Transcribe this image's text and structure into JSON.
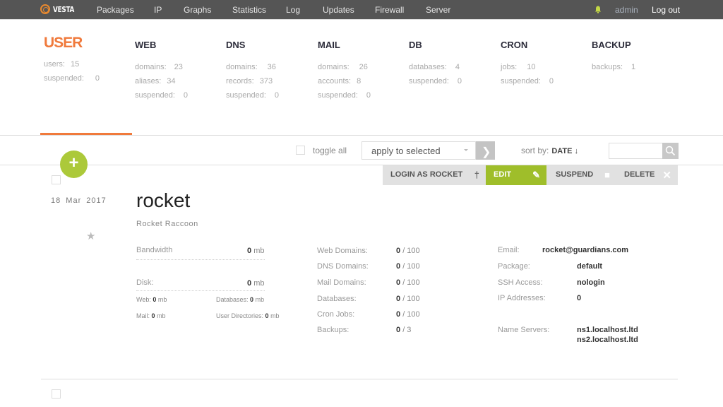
{
  "topbar": {
    "logo_text": "VESTA",
    "nav": [
      "Packages",
      "IP",
      "Graphs",
      "Statistics",
      "Log",
      "Updates",
      "Firewall",
      "Server"
    ],
    "user": "admin",
    "logout": "Log out",
    "bell_color": "#c3d746"
  },
  "stats": {
    "user": {
      "title": "USER",
      "rows": [
        {
          "k": "users:",
          "v": "15"
        },
        {
          "k": "suspended:",
          "v": "0"
        }
      ]
    },
    "web": {
      "title": "WEB",
      "rows": [
        {
          "k": "domains:",
          "v": "23"
        },
        {
          "k": "aliases:",
          "v": "34"
        },
        {
          "k": "suspended:",
          "v": "0"
        }
      ]
    },
    "dns": {
      "title": "DNS",
      "rows": [
        {
          "k": "domains:",
          "v": "36"
        },
        {
          "k": "records:",
          "v": "373"
        },
        {
          "k": "suspended:",
          "v": "0"
        }
      ]
    },
    "mail": {
      "title": "MAIL",
      "rows": [
        {
          "k": "domains:",
          "v": "26"
        },
        {
          "k": "accounts:",
          "v": "8"
        },
        {
          "k": "suspended:",
          "v": "0"
        }
      ]
    },
    "db": {
      "title": "DB",
      "rows": [
        {
          "k": "databases:",
          "v": "4"
        },
        {
          "k": "suspended:",
          "v": "0"
        }
      ]
    },
    "cron": {
      "title": "CRON",
      "rows": [
        {
          "k": "jobs:",
          "v": "10"
        },
        {
          "k": "suspended:",
          "v": "0"
        }
      ]
    },
    "backup": {
      "title": "BACKUP",
      "rows": [
        {
          "k": "backups:",
          "v": "1"
        }
      ]
    }
  },
  "toolbar": {
    "toggle_all": "toggle all",
    "apply_selected": "apply to selected",
    "sort_by": "sort by:",
    "sort_field": "DATE ↓",
    "search_placeholder": ""
  },
  "actions": {
    "login_as": "LOGIN AS ROCKET",
    "edit": "EDIT",
    "suspend": "SUSPEND",
    "delete": "DELETE"
  },
  "user_item": {
    "date": "18 Mar 2017",
    "username": "rocket",
    "fullname": "Rocket Raccoon",
    "bandwidth_label": "Bandwidth",
    "bandwidth_value": "0",
    "disk_label": "Disk:",
    "disk_value": "0",
    "unit": "mb",
    "disk_breakdown": {
      "web_label": "Web:",
      "web_value": "0",
      "mail_label": "Mail:",
      "mail_value": "0",
      "databases_label": "Databases:",
      "databases_value": "0",
      "userdirs_label": "User Directories:",
      "userdirs_value": "0"
    },
    "limits": [
      {
        "label": "Web Domains:",
        "used": "0",
        "max": "/ 100"
      },
      {
        "label": "DNS Domains:",
        "used": "0",
        "max": "/ 100"
      },
      {
        "label": "Mail Domains:",
        "used": "0",
        "max": "/ 100"
      },
      {
        "label": "Databases:",
        "used": "0",
        "max": "/ 100"
      },
      {
        "label": "Cron Jobs:",
        "used": "0",
        "max": "/ 100"
      },
      {
        "label": "Backups:",
        "used": "0",
        "max": "/ 3"
      }
    ],
    "info": {
      "email_label": "Email:",
      "email": "rocket@guardians.com",
      "package_label": "Package:",
      "package": "default",
      "ssh_label": "SSH Access:",
      "ssh": "nologin",
      "ip_label": "IP Addresses:",
      "ip": "0",
      "ns_label": "Name Servers:",
      "ns1": "ns1.localhost.ltd",
      "ns2": "ns2.localhost.ltd"
    }
  },
  "colors": {
    "accent": "#f07a3c",
    "green": "#9fbe2a",
    "topbar": "#555555"
  }
}
